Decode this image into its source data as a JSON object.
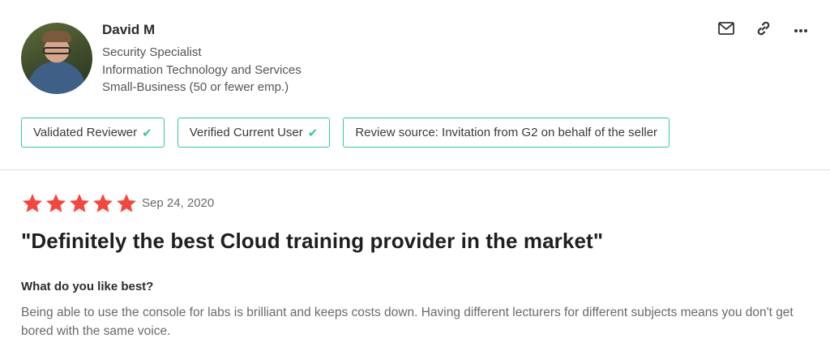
{
  "reviewer": {
    "name": "David M",
    "title": "Security Specialist",
    "industry": "Information Technology and Services",
    "company_size": "Small-Business (50 or fewer emp.)"
  },
  "actions": [
    {
      "icon": "mail-icon"
    },
    {
      "icon": "link-icon"
    },
    {
      "icon": "more-icon"
    }
  ],
  "badges": [
    {
      "label": "Validated Reviewer",
      "check": true
    },
    {
      "label": "Verified Current User",
      "check": true
    },
    {
      "label": "Review source: Invitation from G2 on behalf of the seller",
      "check": false
    }
  ],
  "review": {
    "rating": 5,
    "rating_max": 5,
    "star_color": "#f5463b",
    "date": "Sep 24, 2020",
    "title": "\"Definitely the best Cloud training provider in the market\"",
    "question": "What do you like best?",
    "answer": "Being able to use the console for labs is brilliant and keeps costs down. Having different lecturers for different subjects means you don't get bored with the same voice."
  },
  "colors": {
    "accent": "#38c6a5",
    "star": "#f5463b"
  }
}
